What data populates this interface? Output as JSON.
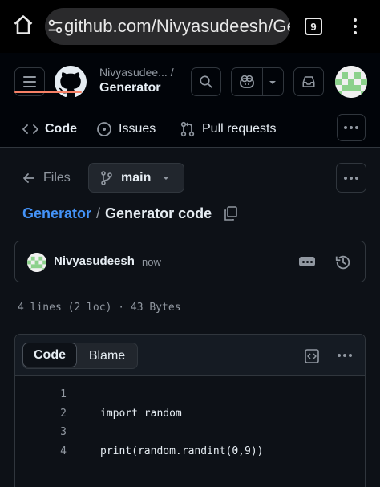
{
  "browser": {
    "url": "github.com/Nivyasudeesh/Ge",
    "tab_count": "9"
  },
  "header": {
    "owner": "Nivyasudee... /",
    "repo": "Generator"
  },
  "repo_nav": [
    {
      "label": "Code"
    },
    {
      "label": "Issues"
    },
    {
      "label": "Pull requests"
    }
  ],
  "files_bar": {
    "files_label": "Files",
    "branch": "main"
  },
  "breadcrumb": {
    "repo": "Generator",
    "separator": "/",
    "file": "Generator code"
  },
  "commit": {
    "author": "Nivyasudeesh",
    "time": "now"
  },
  "file_meta": "4 lines (2 loc) · 43 Bytes",
  "code_view": {
    "tab_code": "Code",
    "tab_blame": "Blame",
    "lines": [
      {
        "n": "1",
        "text": ""
      },
      {
        "n": "2",
        "text": "import random"
      },
      {
        "n": "3",
        "text": ""
      },
      {
        "n": "4",
        "text": "print(random.randint(0,9))"
      }
    ]
  },
  "colors": {
    "background": "#0d1117",
    "link": "#4493f8",
    "active_tab_underline": "#f78166",
    "avatar_green": "#8bd18b"
  }
}
